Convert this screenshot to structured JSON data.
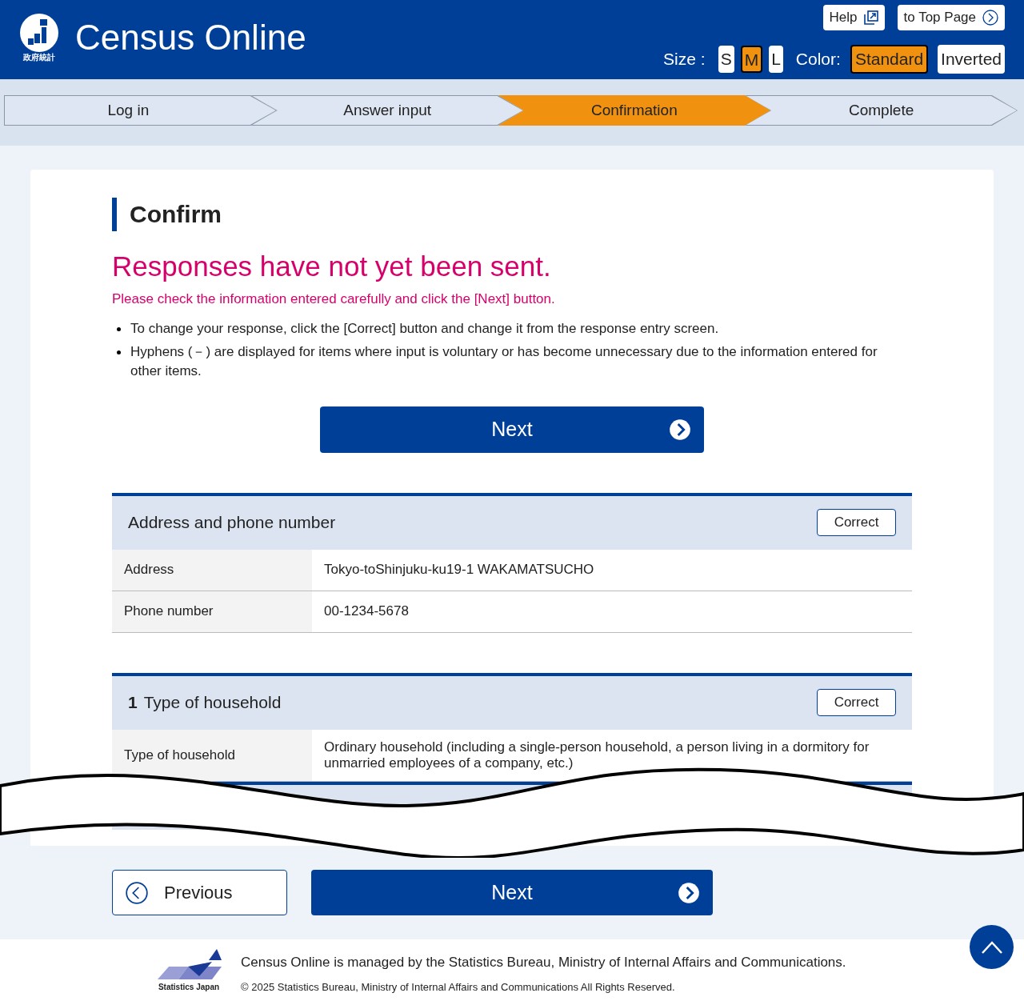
{
  "header": {
    "logo_caption": "政府統計",
    "title": "Census Online",
    "help": "Help",
    "top_page": "to Top Page",
    "size_label": "Size :",
    "sizes": [
      {
        "label": "S",
        "selected": false
      },
      {
        "label": "M",
        "selected": true
      },
      {
        "label": "L",
        "selected": false
      }
    ],
    "color_label": "Color:",
    "colors": [
      {
        "label": "Standard",
        "selected": true
      },
      {
        "label": "Inverted",
        "selected": false
      }
    ]
  },
  "steps": [
    {
      "label": "Log in",
      "selected": false
    },
    {
      "label": "Answer input",
      "selected": false
    },
    {
      "label": "Confirmation",
      "selected": true
    },
    {
      "label": "Complete",
      "selected": false
    }
  ],
  "heading": "Confirm",
  "warning": "Responses have not yet been sent.",
  "instruction": "Please check the information entered carefully and click the [Next] button.",
  "notes": [
    "To change your response, click the [Correct] button and change it from the response entry screen.",
    "Hyphens (－) are displayed for items where input is voluntary or has become unnecessary due to the information entered for other items."
  ],
  "next_button": "Next",
  "sections": [
    {
      "title": "Address and phone number",
      "correct": "Correct",
      "rows": [
        {
          "label": "Address",
          "value": "Tokyo-toShinjuku-ku19-1 WAKAMATSUCHO"
        },
        {
          "label": "Phone number",
          "value": "00-1234-5678"
        }
      ]
    },
    {
      "number": "1",
      "title": "Type of household",
      "correct": "Correct",
      "rows": [
        {
          "label": "Type of household",
          "value": "Ordinary household (including a single-person household, a person living in a dormitory for unmarried employees of a company, etc.)"
        }
      ]
    }
  ],
  "previous_button": "Previous",
  "bottom_next_button": "Next",
  "footer": {
    "logo_caption": "Statistics Japan",
    "managed": "Census Online is managed by the Statistics Bureau, Ministry of Internal Affairs and Communications.",
    "copyright": "© 2025 Statistics Bureau, Ministry of Internal Affairs and Communications All Rights Reserved."
  }
}
